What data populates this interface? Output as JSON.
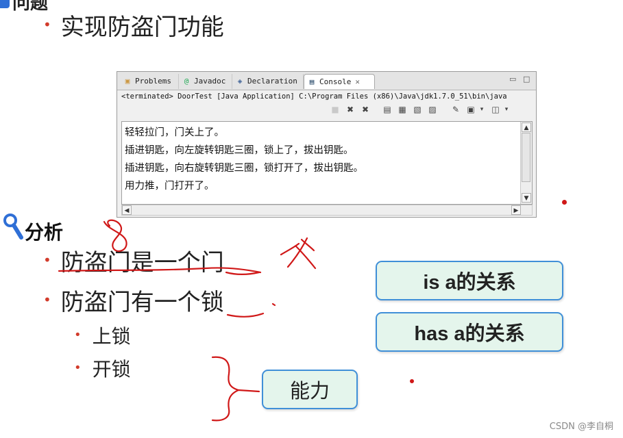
{
  "slide": {
    "top_heading_fragment": "问题",
    "problem_bullet": "实现防盗门功能",
    "analysis_heading": "分析",
    "points": [
      "防盗门是一个门",
      "防盗门有一个锁"
    ],
    "subpoints": [
      "上锁",
      "开锁"
    ],
    "relation_boxes": [
      "is a的关系",
      "has a的关系"
    ],
    "ability_box": "能力"
  },
  "console_window": {
    "tabs": [
      {
        "label": "Problems",
        "icon": "problems-icon",
        "active": false
      },
      {
        "label": "Javadoc",
        "icon": "javadoc-at-icon",
        "active": false
      },
      {
        "label": "Declaration",
        "icon": "declaration-icon",
        "active": false
      },
      {
        "label": "Console",
        "icon": "console-icon",
        "active": true
      }
    ],
    "status": "<terminated> DoorTest [Java Application] C:\\Program Files (x86)\\Java\\jdk1.7.0_51\\bin\\java",
    "output_lines": [
      "轻轻拉门，门关上了。",
      "插进钥匙，向左旋转钥匙三圈，锁上了，拔出钥匙。",
      "插进钥匙，向右旋转钥匙三圈，锁打开了，拔出钥匙。",
      "用力推，门打开了。"
    ]
  },
  "watermark": "CSDN @李自桐",
  "colors": {
    "bullet": "#d23b2b",
    "box_border": "#3f8fd8",
    "box_fill": "#e4f5ec",
    "ink": "#d01818"
  }
}
